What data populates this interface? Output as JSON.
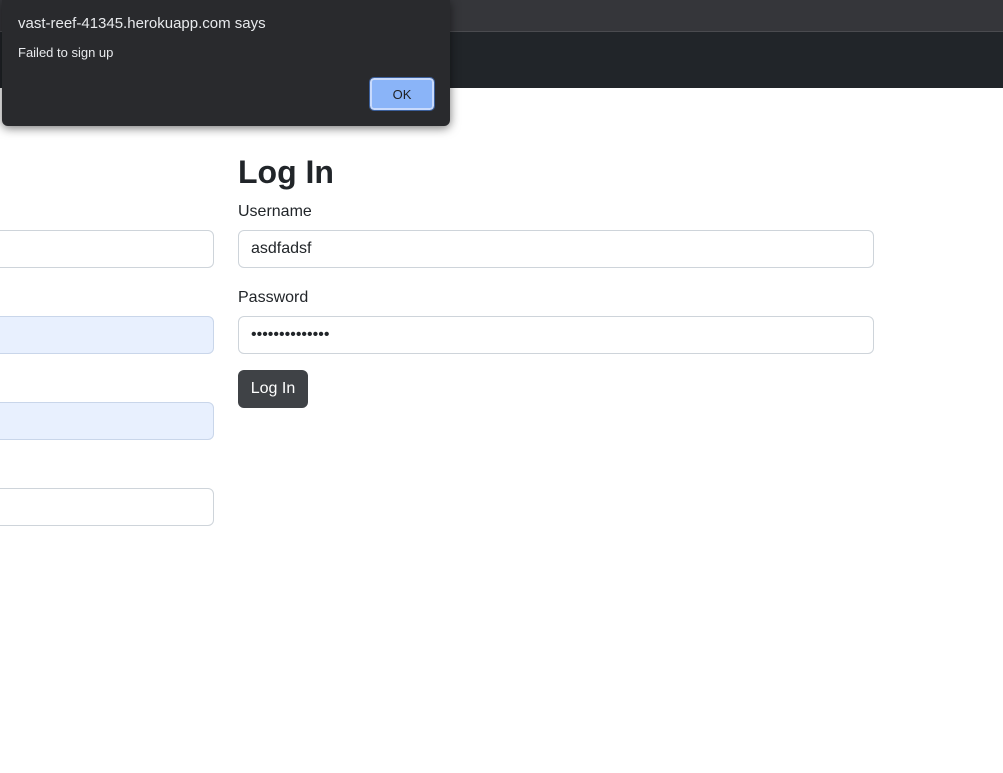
{
  "alert": {
    "title": "vast-reef-41345.herokuapp.com says",
    "message": "Failed to sign up",
    "ok_label": "OK"
  },
  "login": {
    "title": "Log In",
    "username_label": "Username",
    "username_value": "asdfadsf",
    "password_label": "Password",
    "password_value": "••••••••••••••",
    "submit_label": "Log In"
  }
}
